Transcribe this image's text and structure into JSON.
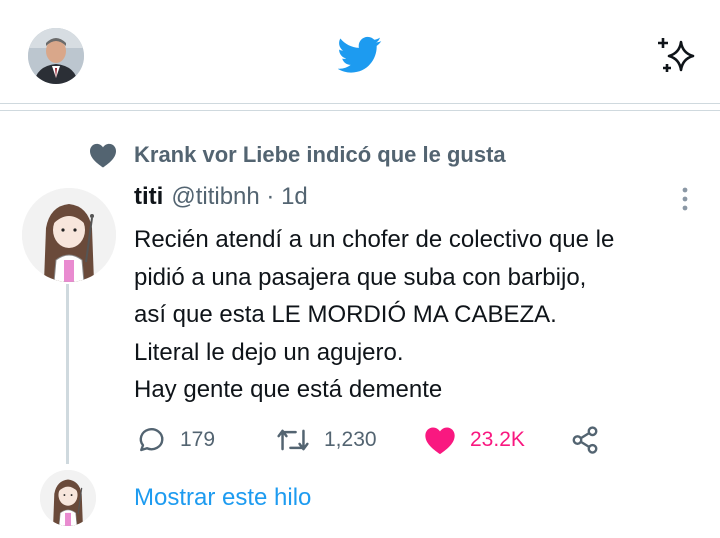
{
  "header": {
    "profile_avatar": "profile-photo",
    "logo": "twitter-bird-icon",
    "sparkle": "sparkle-icon",
    "brand_color": "#1d9bf0"
  },
  "social_context": {
    "icon": "heart-icon",
    "text": "Krank vor Liebe indicó que le gusta"
  },
  "tweet": {
    "author_name": "titi",
    "meta": "@titibnh · 1d",
    "lines": [
      "Recién atendí a un chofer de colectivo que le",
      "pidió a una pasajera que suba con barbijo,",
      "así que esta LE MORDIÓ MA CABEZA.",
      "Literal le dejo un agujero.",
      "Hay gente que está demente"
    ],
    "replies": "179",
    "retweets": "1,230",
    "likes": "23.2K",
    "like_color": "#f91880"
  },
  "thread": {
    "show_thread_label": "Mostrar este hilo"
  }
}
